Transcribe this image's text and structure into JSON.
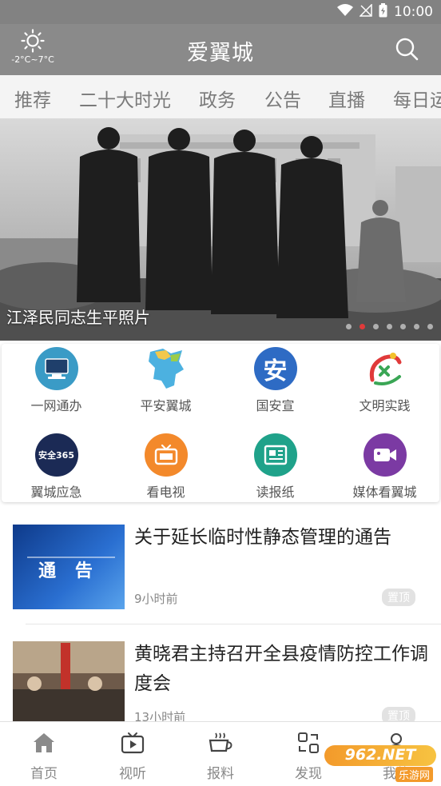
{
  "status_bar": {
    "time": "10:00"
  },
  "header": {
    "title": "爱翼城",
    "weather_temp": "-2°C~7°C"
  },
  "tabs": [
    "推荐",
    "二十大时光",
    "政务",
    "公告",
    "直播",
    "每日运"
  ],
  "banner": {
    "caption": "江泽民同志生平照片",
    "dot_count": 7,
    "active_dot": 1
  },
  "shortcuts": [
    {
      "label": "一网通办",
      "icon": "computer-icon",
      "color": "#3a9bc6"
    },
    {
      "label": "平安翼城",
      "icon": "map-icon",
      "color": "#4cb1e0"
    },
    {
      "label": "国安宣",
      "icon": "an-character-icon",
      "color": "#2e6bc4",
      "glyph": "安"
    },
    {
      "label": "文明实践",
      "icon": "civilization-logo-icon",
      "color": "#e03a3a"
    },
    {
      "label": "翼城应急",
      "icon": "safety-365-icon",
      "color": "#1b2a55",
      "glyph": "安全365"
    },
    {
      "label": "看电视",
      "icon": "tv-icon",
      "color": "#f3892b"
    },
    {
      "label": "读报纸",
      "icon": "newspaper-icon",
      "color": "#1fa28a"
    },
    {
      "label": "媒体看翼城",
      "icon": "video-camera-icon",
      "color": "#7b3aa3"
    }
  ],
  "news": [
    {
      "title": "关于延长临时性静态管理的通告",
      "time": "9小时前",
      "tag": "置顶",
      "thumb_text": "通 告"
    },
    {
      "title": "黄晓君主持召开全县疫情防控工作调度会",
      "time": "13小时前",
      "tag": "置顶"
    }
  ],
  "bottom_nav": [
    {
      "label": "首页",
      "icon": "home-icon"
    },
    {
      "label": "视听",
      "icon": "tv-play-icon"
    },
    {
      "label": "报料",
      "icon": "coffee-cup-icon"
    },
    {
      "label": "发现",
      "icon": "discover-icon"
    },
    {
      "label": "我的",
      "icon": "user-icon"
    }
  ],
  "watermark": {
    "text": "962.NET",
    "subtext": "乐游网"
  }
}
